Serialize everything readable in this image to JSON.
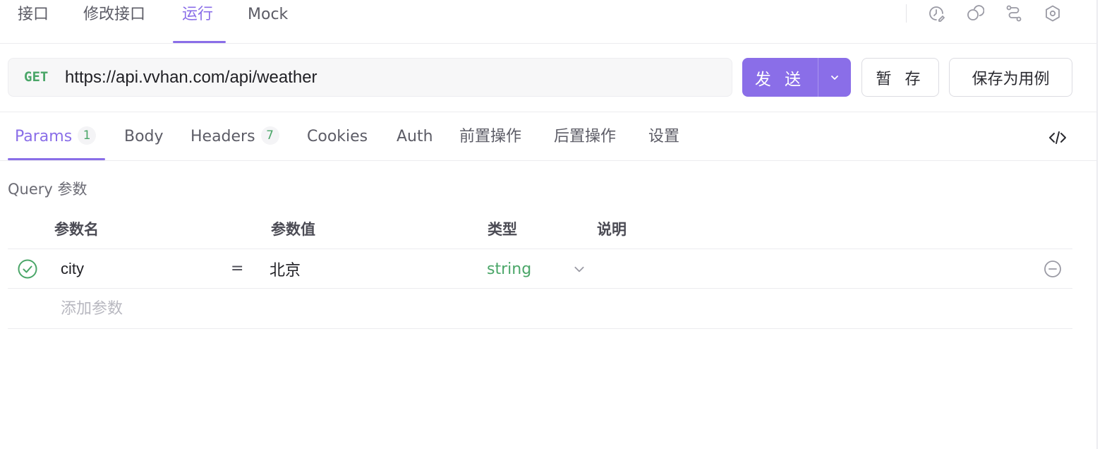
{
  "top_tabs": [
    {
      "label": "接口"
    },
    {
      "label": "修改接口"
    },
    {
      "label": "运行",
      "active": true
    },
    {
      "label": "Mock"
    }
  ],
  "top_icons": [
    "history-icon",
    "share-icon",
    "flow-icon",
    "settings-icon"
  ],
  "request": {
    "method": "GET",
    "url": "https://api.vvhan.com/api/weather",
    "send_label": "发 送",
    "save_temp_label": "暂 存",
    "save_example_label": "保存为用例"
  },
  "request_tabs": [
    {
      "label": "Params",
      "count": "1",
      "active": true
    },
    {
      "label": "Body"
    },
    {
      "label": "Headers",
      "count": "7"
    },
    {
      "label": "Cookies"
    },
    {
      "label": "Auth"
    },
    {
      "label": "前置操作"
    },
    {
      "label": "后置操作"
    },
    {
      "label": "设置"
    }
  ],
  "query": {
    "title": "Query 参数",
    "headers": {
      "name": "参数名",
      "value": "参数值",
      "type": "类型",
      "desc": "说明"
    },
    "rows": [
      {
        "enabled": true,
        "name": "city",
        "equals": "=",
        "value": "北京",
        "type": "string",
        "desc": ""
      }
    ],
    "add_placeholder": "添加参数"
  },
  "colors": {
    "accent": "#8a6ee8",
    "method_get": "#4aa668",
    "type_string": "#4aa668"
  }
}
